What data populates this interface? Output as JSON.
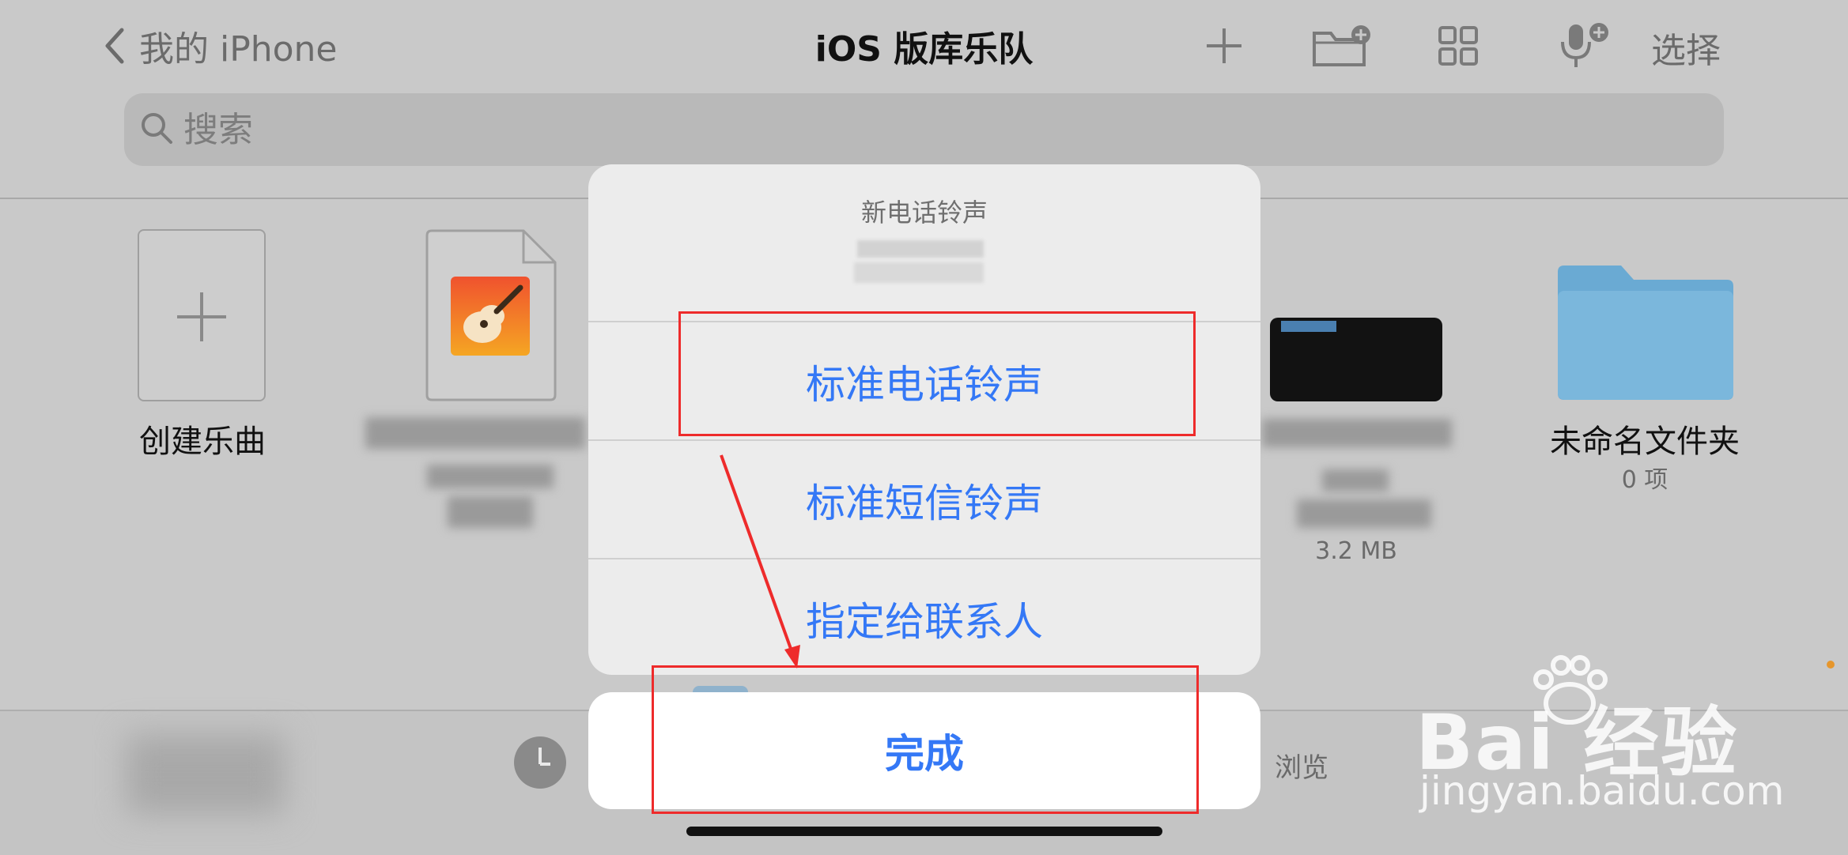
{
  "nav": {
    "back_label": "我的 iPhone",
    "title": "iOS 版库乐队",
    "select_label": "选择",
    "icons": [
      "plus-icon",
      "new-folder-icon",
      "grid-view-icon",
      "mic-add-icon"
    ]
  },
  "search": {
    "placeholder": "搜索"
  },
  "files": {
    "create_label": "创建乐曲",
    "doc_icon": "garageband-icon",
    "file_size": "3.2 MB",
    "folder_label": "未命名文件夹",
    "folder_count": "0 项"
  },
  "tabbar": {
    "browse_label": "浏览",
    "recent_icon": "clock-icon"
  },
  "sheet": {
    "title": "新电话铃声",
    "items": [
      "标准电话铃声",
      "标准短信铃声",
      "指定给联系人"
    ],
    "done_label": "完成"
  },
  "watermark": {
    "main": "Bai 经验",
    "sub": "jingyan.baidu.com"
  },
  "colors": {
    "accent": "#3478f6",
    "annotation_red": "#ee2b2b",
    "folder_blue": "#74b2d8"
  }
}
